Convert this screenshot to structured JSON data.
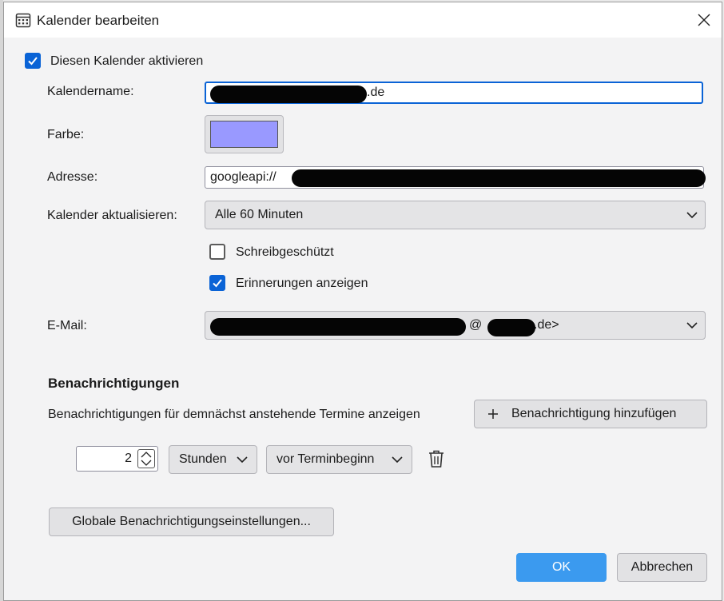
{
  "window": {
    "title": "Kalender bearbeiten"
  },
  "enable_calendar": {
    "label": "Diesen Kalender aktivieren",
    "checked": true
  },
  "calendar_name": {
    "label": "Kalendername:",
    "value_suffix": ".de"
  },
  "color": {
    "label": "Farbe:",
    "value": "#9999ff"
  },
  "address": {
    "label": "Adresse:",
    "value_prefix": "googleapi://"
  },
  "refresh": {
    "label": "Kalender aktualisieren:",
    "value": "Alle 60 Minuten"
  },
  "read_only": {
    "label": "Schreibgeschützt",
    "checked": false
  },
  "show_reminders": {
    "label": "Erinnerungen anzeigen",
    "checked": true
  },
  "email": {
    "label": "E-Mail:",
    "visible_parts": [
      "@",
      ".de>"
    ]
  },
  "notifications": {
    "heading": "Benachrichtigungen",
    "description": "Benachrichtigungen für demnächst anstehende Termine anzeigen",
    "add_button": "Benachrichtigung hinzufügen",
    "item": {
      "amount": "2",
      "unit": "Stunden",
      "relation": "vor Terminbeginn"
    },
    "global_settings_button": "Globale Benachrichtigungseinstellungen..."
  },
  "buttons": {
    "ok": "OK",
    "cancel": "Abbrechen"
  },
  "colors": {
    "accent": "#0a63d6",
    "primary_button": "#3b9aef",
    "redaction": "#050505"
  }
}
